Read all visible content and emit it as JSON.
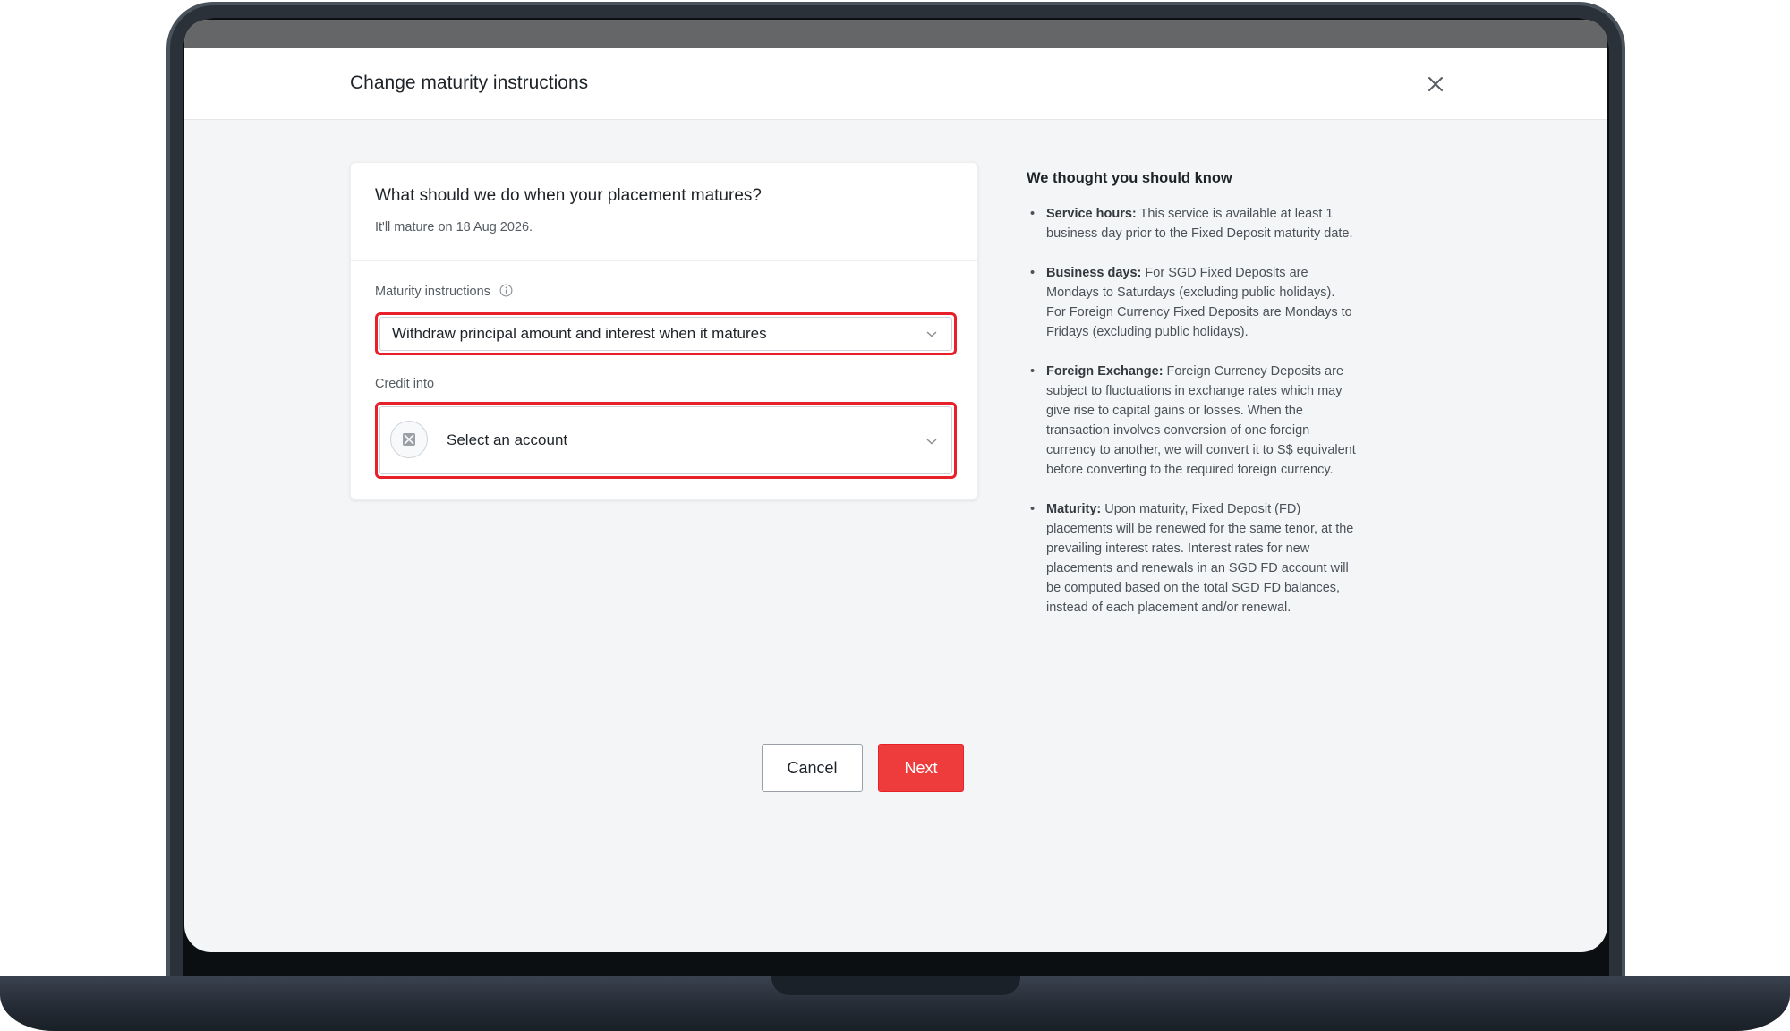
{
  "modal": {
    "title": "Change maturity instructions",
    "close_icon": "close-icon"
  },
  "card": {
    "question": "What should we do when your placement matures?",
    "subtitle": "It'll mature on 18 Aug 2026.",
    "maturity_label": "Maturity instructions",
    "maturity_value": "Withdraw principal amount and interest when it matures",
    "credit_label": "Credit into",
    "credit_placeholder": "Select an account"
  },
  "info": {
    "title": "We thought you should know",
    "items": [
      {
        "heading": "Service hours:",
        "text": " This service is available at least 1 business day prior to the Fixed Deposit maturity date."
      },
      {
        "heading": "Business days:",
        "text": " For SGD Fixed Deposits are Mondays to Saturdays (excluding public holidays). For Foreign Currency Fixed Deposits are Mondays to Fridays (excluding public holidays)."
      },
      {
        "heading": "Foreign Exchange:",
        "text": " Foreign Currency Deposits are subject to fluctuations in exchange rates which may give rise to capital gains or losses. When the transaction involves conversion of one foreign currency to another, we will convert it to S$ equivalent before converting to the required foreign currency."
      },
      {
        "heading": "Maturity:",
        "text": " Upon maturity, Fixed Deposit (FD) placements will be renewed for the same tenor, at the prevailing interest rates. Interest rates for new placements and renewals in an SGD FD account will be computed based on the total SGD FD balances, instead of each placement and/or renewal."
      }
    ]
  },
  "buttons": {
    "cancel": "Cancel",
    "next": "Next"
  },
  "colors": {
    "accent": "#ee3b3b",
    "highlight_border": "#e8202a"
  }
}
